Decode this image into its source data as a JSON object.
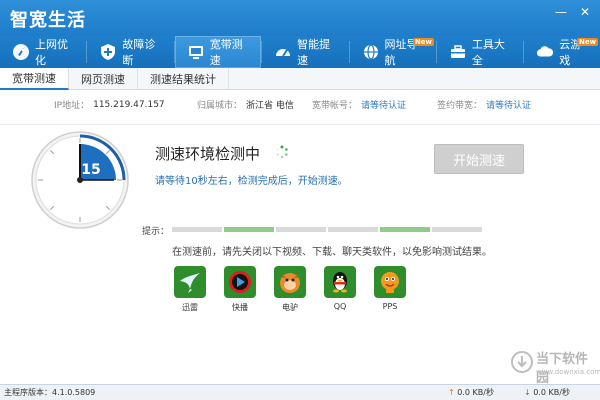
{
  "window": {
    "title": "智宽生活",
    "controls": {
      "minimize": "—",
      "close": "✕"
    }
  },
  "nav": {
    "items": [
      {
        "label": "上网优化",
        "icon": "rocket-icon"
      },
      {
        "label": "故障诊断",
        "icon": "shield-plus-icon"
      },
      {
        "label": "宽带测速",
        "icon": "monitor-icon"
      },
      {
        "label": "智能提速",
        "icon": "speedometer-icon"
      },
      {
        "label": "网址导航",
        "icon": "globe-icon",
        "badge": "New"
      },
      {
        "label": "工具大全",
        "icon": "toolbox-icon"
      },
      {
        "label": "云游戏",
        "icon": "cloud-icon",
        "badge": "New"
      }
    ],
    "active_index": 2
  },
  "subtabs": {
    "items": [
      "宽带测速",
      "网页测速",
      "测速结果统计"
    ],
    "active_index": 0
  },
  "info": {
    "ip_label": "IP地址：",
    "ip_value": "115.219.47.157",
    "city_label": "归属城市：",
    "city_value": "浙江省 电信",
    "account_label": "宽带帐号：",
    "account_value": "请等待认证",
    "contract_label": "签约带宽：",
    "contract_value": "请等待认证"
  },
  "test": {
    "dial_value": "15",
    "dial_progress": 0.25,
    "status_title": "测速环境检测中",
    "status_sub": "请等待10秒左右，检测完成后，开始测速。",
    "start_button": "开始测速",
    "hint_label": "提示：",
    "progress_segments": [
      "gray",
      "green",
      "gray",
      "gray",
      "green",
      "gray"
    ],
    "notice": "在测速前，请先关闭以下视频、下载、聊天类软件，以免影响测试结果。"
  },
  "apps": [
    {
      "label": "迅雷",
      "icon": "thunder-bird-icon",
      "color": "#2f8d2c"
    },
    {
      "label": "快播",
      "icon": "qvod-play-icon",
      "color": "#2f8d2c"
    },
    {
      "label": "电驴",
      "icon": "emule-donkey-icon",
      "color": "#2f8d2c"
    },
    {
      "label": "QQ",
      "icon": "qq-penguin-icon",
      "color": "#2f8d2c"
    },
    {
      "label": "PPS",
      "icon": "pps-mascot-icon",
      "color": "#2f8d2c"
    }
  ],
  "watermark": {
    "title": "当下软件园",
    "url": "www.downxia.com"
  },
  "statusbar": {
    "version": "主程序版本：4.1.0.5809",
    "upload": "0.0 KB/秒",
    "download": "0.0 KB/秒"
  }
}
